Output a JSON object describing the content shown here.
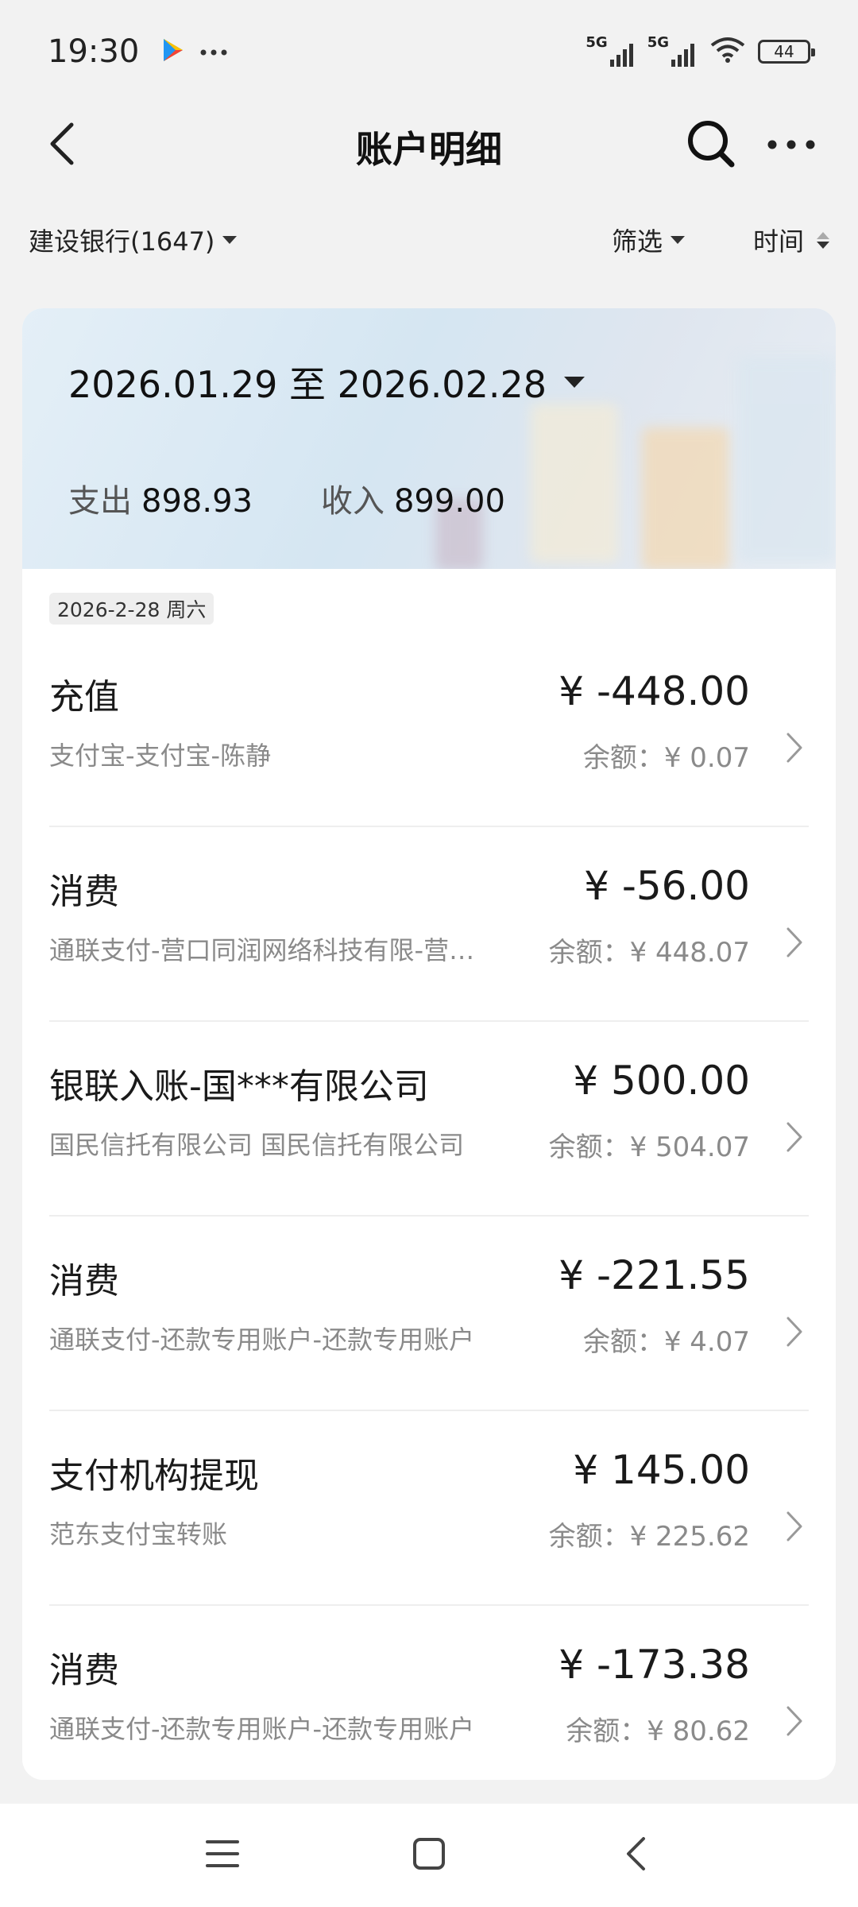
{
  "status_bar": {
    "time": "19:30",
    "network_1": "5G",
    "network_2": "5G",
    "battery": "44",
    "icons": [
      "play-store-icon",
      "more-notifications-icon",
      "signal-icon",
      "signal-icon",
      "wifi-icon",
      "battery-icon"
    ]
  },
  "header": {
    "title": "账户明细",
    "icons": [
      "back-icon",
      "search-icon",
      "more-icon"
    ]
  },
  "filters": {
    "account": "建设银行(1647)",
    "filter_label": "筛选",
    "sort_label": "时间"
  },
  "summary": {
    "date_range": "2026.01.29 至 2026.02.28",
    "expense_label": "支出",
    "expense_value": "898.93",
    "income_label": "收入",
    "income_value": "899.00"
  },
  "day_header": "2026-2-28 周六",
  "transactions": [
    {
      "title": "充值",
      "amount": "¥ -448.00",
      "desc": "支付宝-支付宝-陈静",
      "balance": "余额：¥ 0.07"
    },
    {
      "title": "消费",
      "amount": "¥ -56.00",
      "desc": "通联支付-营口同润网络科技有限-营…",
      "balance": "余额：¥ 448.07"
    },
    {
      "title": "银联入账-国***有限公司",
      "amount": "¥ 500.00",
      "desc": "国民信托有限公司 国民信托有限公司",
      "balance": "余额：¥ 504.07"
    },
    {
      "title": "消费",
      "amount": "¥ -221.55",
      "desc": "通联支付-还款专用账户-还款专用账户",
      "balance": "余额：¥ 4.07"
    },
    {
      "title": "支付机构提现",
      "amount": "¥ 145.00",
      "desc": "范东支付宝转账",
      "balance": "余额：¥ 225.62"
    },
    {
      "title": "消费",
      "amount": "¥ -173.38",
      "desc": "通联支付-还款专用账户-还款专用账户",
      "balance": "余额：¥ 80.62"
    }
  ],
  "nav": {
    "icons": [
      "menu-icon",
      "home-icon",
      "back-icon"
    ]
  },
  "colors": {
    "background": "#f2f2f2",
    "card": "#ffffff",
    "text_primary": "#1a1a1a",
    "text_secondary": "#8a8a8a"
  }
}
